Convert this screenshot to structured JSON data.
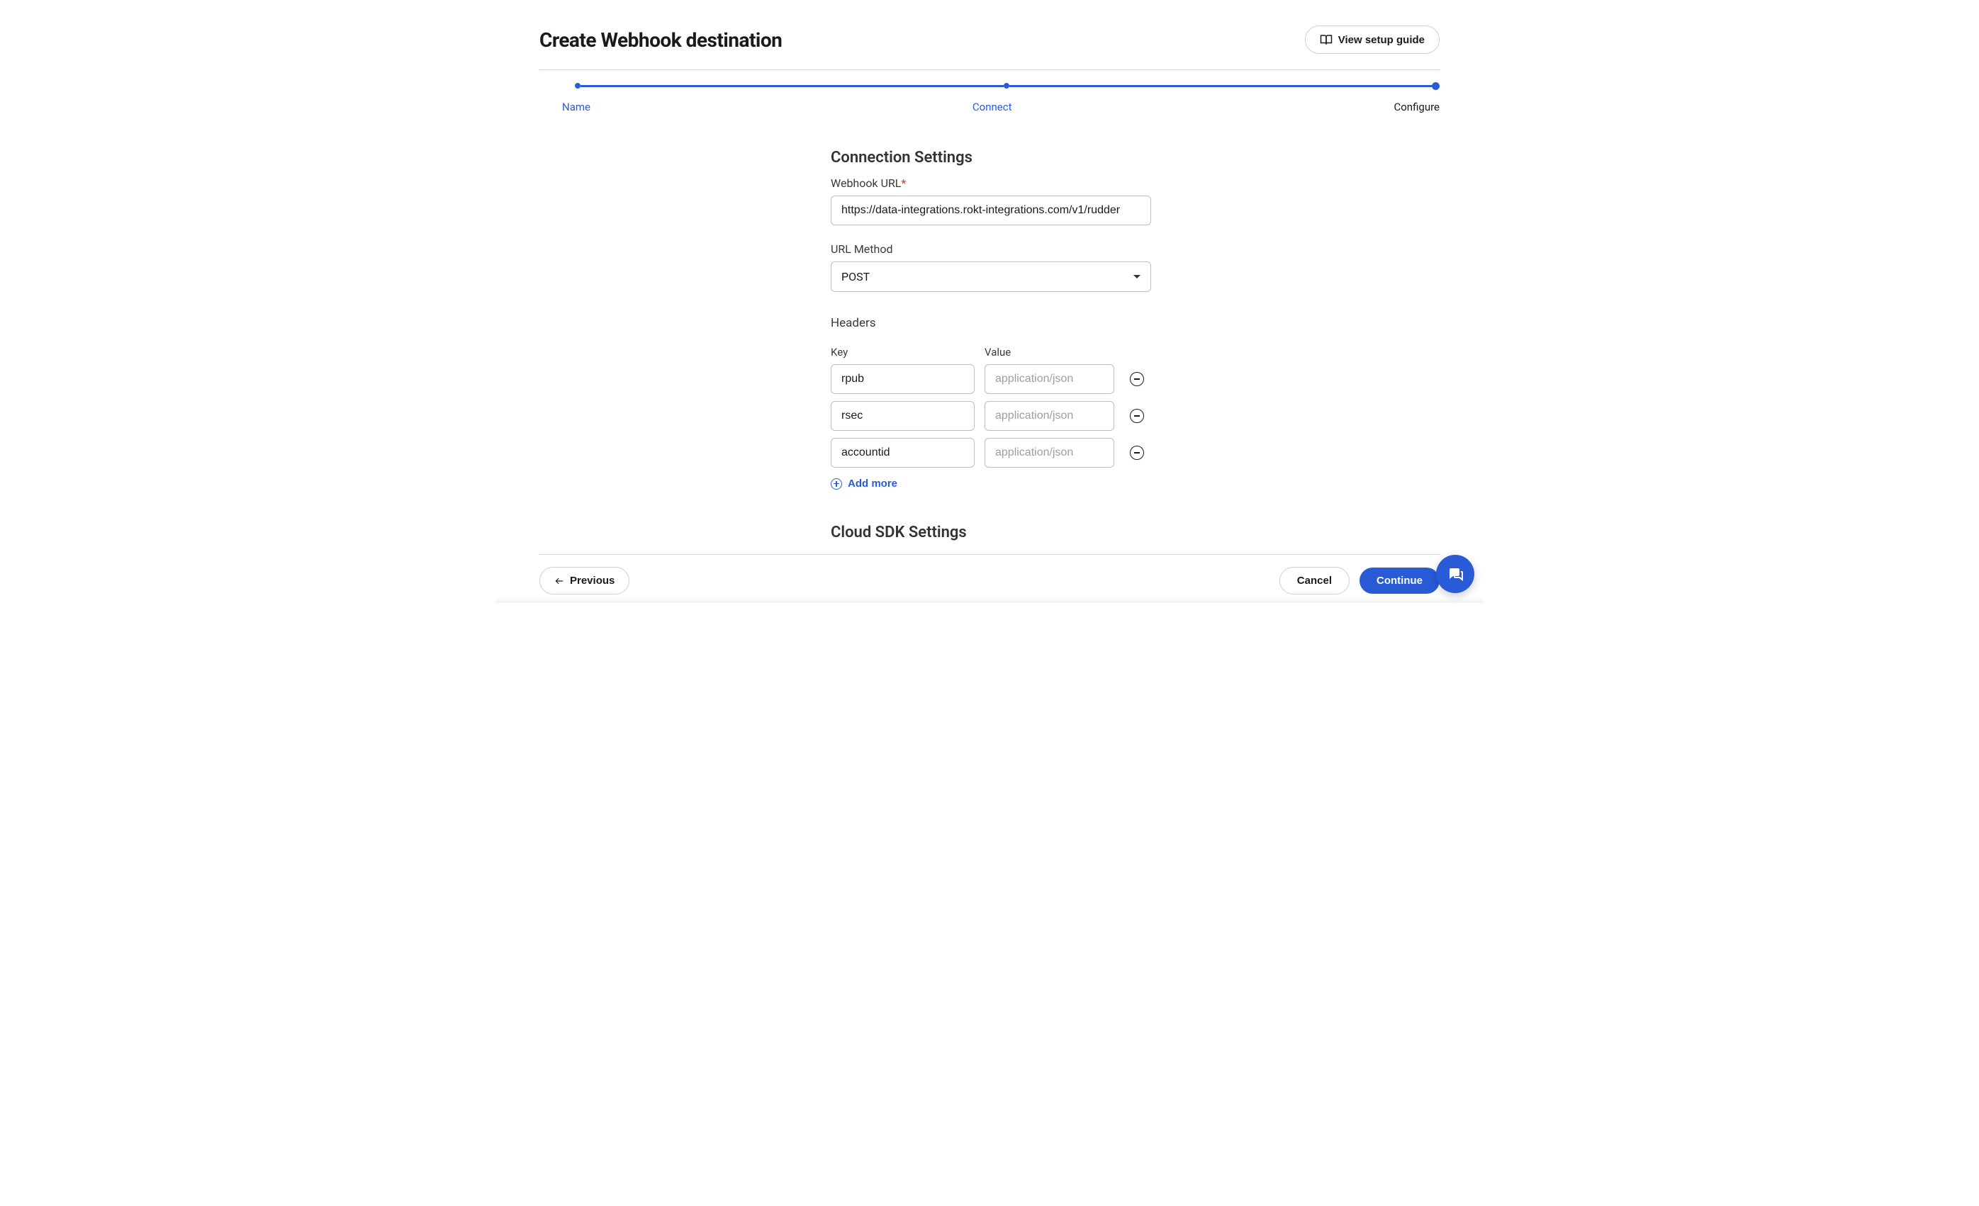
{
  "header": {
    "title": "Create Webhook destination",
    "setup_guide_label": "View setup guide"
  },
  "stepper": {
    "steps": [
      "Name",
      "Connect",
      "Configure"
    ],
    "active_index": 2
  },
  "form": {
    "section_title": "Connection Settings",
    "webhook_url": {
      "label": "Webhook URL",
      "required": true,
      "value": "https://data-integrations.rokt-integrations.com/v1/rudder"
    },
    "url_method": {
      "label": "URL Method",
      "value": "POST"
    },
    "headers": {
      "title": "Headers",
      "key_label": "Key",
      "value_label": "Value",
      "value_placeholder": "application/json",
      "rows": [
        {
          "key": "rpub",
          "value": ""
        },
        {
          "key": "rsec",
          "value": ""
        },
        {
          "key": "accountid",
          "value": ""
        }
      ],
      "add_more_label": "Add more"
    },
    "cloud_sdk_title": "Cloud SDK Settings"
  },
  "footer": {
    "previous_label": "Previous",
    "cancel_label": "Cancel",
    "continue_label": "Continue"
  },
  "colors": {
    "accent": "#2a5bd7"
  }
}
